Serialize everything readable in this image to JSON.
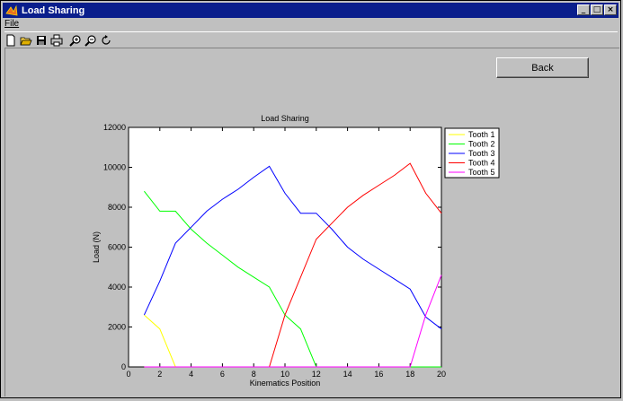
{
  "window": {
    "title": "Load Sharing"
  },
  "menu": {
    "file": "File"
  },
  "toolbar": {
    "icons": [
      "new-icon",
      "open-icon",
      "save-icon",
      "print-icon",
      "zoom-in-icon",
      "zoom-out-icon",
      "rotate-icon"
    ]
  },
  "back_button": "Back",
  "colors": {
    "titlebar": "#0a1e8c",
    "tooth1": "#ffff00",
    "tooth2": "#00ff00",
    "tooth3": "#0000ff",
    "tooth4": "#ff0000",
    "tooth5": "#ff00ff"
  },
  "chart_data": {
    "type": "line",
    "title": "Load Sharing",
    "xlabel": "Kinematics Position",
    "ylabel": "Load (N)",
    "xlim": [
      0,
      20
    ],
    "ylim": [
      0,
      12000
    ],
    "xticks": [
      0,
      2,
      4,
      6,
      8,
      10,
      12,
      14,
      16,
      18,
      20
    ],
    "yticks": [
      0,
      2000,
      4000,
      6000,
      8000,
      10000,
      12000
    ],
    "legend_position": "outside-right-top",
    "series": [
      {
        "name": "Tooth 1",
        "color": "#ffff00",
        "x": [
          1,
          2,
          3,
          4,
          5,
          6,
          7,
          8,
          9,
          10,
          11,
          12,
          13,
          14,
          15,
          16,
          17,
          18,
          19,
          20
        ],
        "y": [
          2600,
          1900,
          0,
          0,
          0,
          0,
          0,
          0,
          0,
          0,
          0,
          0,
          0,
          0,
          0,
          0,
          0,
          0,
          0,
          0
        ]
      },
      {
        "name": "Tooth 2",
        "color": "#00ff00",
        "x": [
          1,
          2,
          3,
          4,
          5,
          6,
          7,
          8,
          9,
          10,
          11,
          12,
          13,
          14,
          15,
          16,
          17,
          18,
          19,
          20
        ],
        "y": [
          8800,
          7800,
          7800,
          6900,
          6200,
          5600,
          5000,
          4500,
          4000,
          2600,
          1900,
          0,
          0,
          0,
          0,
          0,
          0,
          0,
          0,
          0
        ]
      },
      {
        "name": "Tooth 3",
        "color": "#0000ff",
        "x": [
          1,
          2,
          3,
          4,
          5,
          6,
          7,
          8,
          9,
          10,
          11,
          12,
          13,
          14,
          15,
          16,
          17,
          18,
          19,
          20
        ],
        "y": [
          2600,
          4300,
          6200,
          7000,
          7800,
          8400,
          8900,
          9500,
          10050,
          8700,
          7700,
          7700,
          6900,
          6000,
          5400,
          4900,
          4400,
          3900,
          2500,
          1900
        ]
      },
      {
        "name": "Tooth 4",
        "color": "#ff0000",
        "x": [
          1,
          2,
          3,
          4,
          5,
          6,
          7,
          8,
          9,
          10,
          11,
          12,
          13,
          14,
          15,
          16,
          17,
          18,
          19,
          20
        ],
        "y": [
          0,
          0,
          0,
          0,
          0,
          0,
          0,
          0,
          0,
          2600,
          4500,
          6400,
          7200,
          8000,
          8600,
          9100,
          9600,
          10200,
          8700,
          7700
        ]
      },
      {
        "name": "Tooth 5",
        "color": "#ff00ff",
        "x": [
          1,
          2,
          3,
          4,
          5,
          6,
          7,
          8,
          9,
          10,
          11,
          12,
          13,
          14,
          15,
          16,
          17,
          18,
          19,
          20
        ],
        "y": [
          0,
          0,
          0,
          0,
          0,
          0,
          0,
          0,
          0,
          0,
          0,
          0,
          0,
          0,
          0,
          0,
          0,
          0,
          2600,
          4600
        ]
      }
    ]
  }
}
